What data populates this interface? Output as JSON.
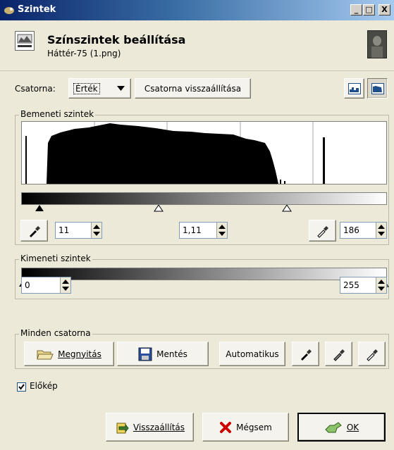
{
  "window": {
    "title": "Szintek",
    "minimize": "_",
    "maximize": "□",
    "close": "X"
  },
  "header": {
    "title": "Színszintek beállítása",
    "subtitle": "Háttér-75 (1.png)"
  },
  "channel": {
    "label": "Csatorna:",
    "value": "Érték",
    "reset_button": "Csatorna visszaállítása"
  },
  "input_levels": {
    "title": "Bemeneti szintek",
    "low": "11",
    "gamma": "1,11",
    "high": "186"
  },
  "output_levels": {
    "title": "Kimeneti szintek",
    "low": "0",
    "high": "255"
  },
  "all_channels": {
    "title": "Minden csatorna",
    "open": "Megnyitás",
    "save": "Mentés",
    "auto": "Automatikus"
  },
  "preview": {
    "label": "Előkép",
    "checked": true
  },
  "footer": {
    "reset": "Visszaállítás",
    "cancel": "Mégsem",
    "ok": "OK"
  }
}
